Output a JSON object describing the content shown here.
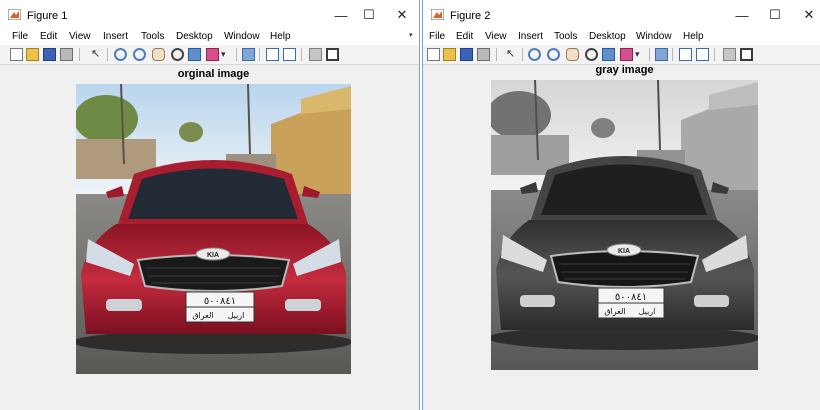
{
  "windows": [
    {
      "title": "Figure 1",
      "axes_title": "orginal image",
      "image_description": "red sedan front view on a street",
      "image_mode": "color"
    },
    {
      "title": "Figure 2",
      "axes_title": "gray image",
      "image_description": "same sedan converted to grayscale",
      "image_mode": "grayscale"
    }
  ],
  "menu": [
    "File",
    "Edit",
    "View",
    "Insert",
    "Tools",
    "Desktop",
    "Window",
    "Help"
  ],
  "window_controls": {
    "minimize": "—",
    "maximize": "☐",
    "close": "✕"
  },
  "toolbar_icons": [
    "new-figure-icon",
    "open-file-icon",
    "save-icon",
    "print-icon",
    "pointer-icon",
    "zoom-in-icon",
    "zoom-out-icon",
    "pan-icon",
    "rotate-3d-icon",
    "data-cursor-icon",
    "brush-icon",
    "link-icon",
    "insert-colorbar-icon",
    "insert-legend-icon",
    "hide-plot-tools-icon",
    "show-plot-tools-icon"
  ],
  "license_plate": {
    "number": "٥٠٠٨٤١",
    "country": "العراق",
    "city": "اربيل"
  },
  "car_badge": "KIA",
  "colors": {
    "car_body": "#b22235",
    "gray_body": "#4c4c4c",
    "window_border": "#7aa3c8"
  }
}
